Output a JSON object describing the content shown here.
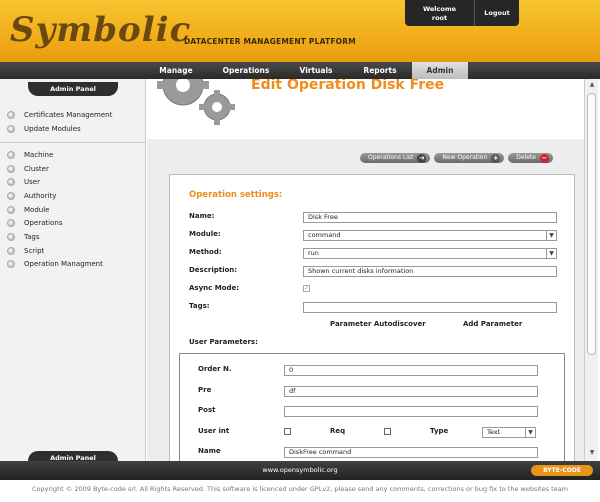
{
  "header": {
    "logo": "Symbolic",
    "tagline": "DATACENTER MANAGEMENT PLATFORM",
    "welcome_line1": "Welcome",
    "welcome_line2": "root",
    "logout": "Logout"
  },
  "nav": {
    "items": [
      {
        "label": "Manage"
      },
      {
        "label": "Operations"
      },
      {
        "label": "Virtuals"
      },
      {
        "label": "Reports"
      },
      {
        "label": "Admin"
      }
    ],
    "active": "Admin"
  },
  "sidebar": {
    "title": "Admin Panel",
    "bottom_title": "Admin Panel",
    "group1": [
      {
        "label": "Certificates Management"
      },
      {
        "label": "Update Modules"
      }
    ],
    "group2": [
      {
        "label": "Machine"
      },
      {
        "label": "Cluster"
      },
      {
        "label": "User"
      },
      {
        "label": "Authority"
      },
      {
        "label": "Module"
      },
      {
        "label": "Operations"
      },
      {
        "label": "Tags"
      },
      {
        "label": "Script"
      },
      {
        "label": "Operation Managment"
      }
    ]
  },
  "main": {
    "title": "Edit Operation Disk Free",
    "actions": {
      "list": "Operations List",
      "new": "New Operation",
      "delete": "Delete"
    },
    "section_title": "Operation settings:",
    "form": {
      "name_label": "Name:",
      "name_value": "Disk Free",
      "module_label": "Module:",
      "module_value": "command",
      "method_label": "Method:",
      "method_value": "run",
      "description_label": "Description:",
      "description_value": "Shown current disks information",
      "async_label": "Async Mode:",
      "async_checked": "✓",
      "tags_label": "Tags:",
      "tags_value": "",
      "autodiscover": "Parameter Autodiscover",
      "add_parameter": "Add Parameter",
      "user_params_label": "User Parameters:"
    },
    "params": {
      "order_label": "Order N.",
      "order_value": "0",
      "pre_label": "Pre",
      "pre_value": "df",
      "post_label": "Post",
      "post_value": "",
      "userint_label": "User int",
      "req_label": "Req",
      "type_label": "Type",
      "type_value": "Text",
      "name_label": "Name",
      "name_value": "DiskFree command"
    }
  },
  "footer": {
    "url": "www.opensymbolic.org",
    "logo": "BYTE-CODE",
    "copyright": "Copyright © 2009 Byte-code srl. All Rights Reserved. This software is licenced under GPLv2, please send any comments, corrections or bug fix to the websites team"
  },
  "colors": {
    "accent": "#f08c1a",
    "header": "#f0a916",
    "nav": "#2a2a2a"
  }
}
